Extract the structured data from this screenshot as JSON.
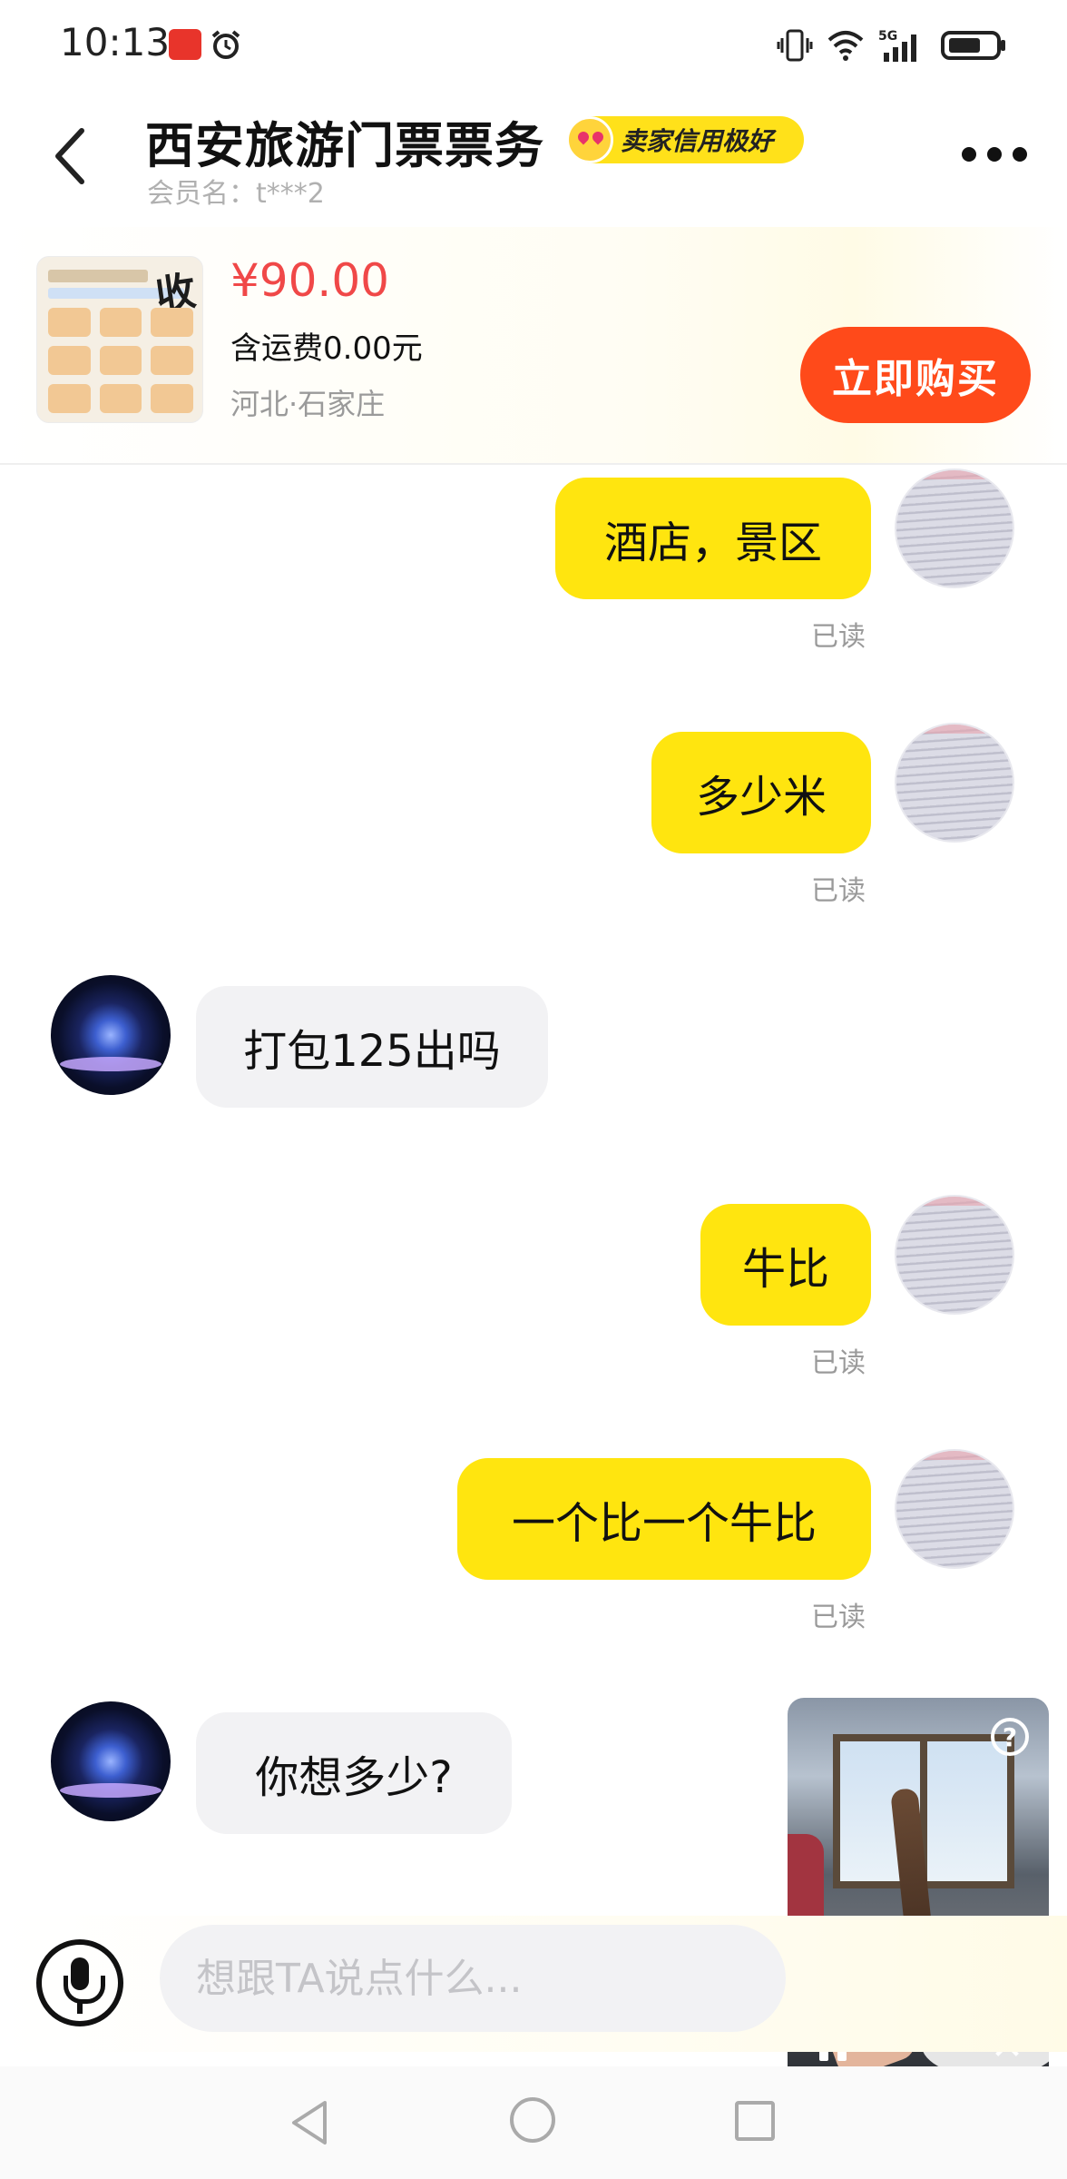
{
  "status_bar": {
    "time": "10:13",
    "icons": [
      "app-notification-icon",
      "alarm-icon",
      "vibrate-icon",
      "wifi-icon",
      "5g-signal-icon",
      "battery-icon"
    ]
  },
  "header": {
    "title": "西安旅游门票票务",
    "credit_badge": "卖家信用极好",
    "member": "会员名：t***2"
  },
  "product": {
    "thumbnail_stamp": "收",
    "price": "¥90.00",
    "shipping": "含运费0.00元",
    "location": "河北·石家庄",
    "buy_label": "立即购买",
    "price_color": "#f04848",
    "buy_color": "#ff4a1a"
  },
  "messages": [
    {
      "side": "mine",
      "text": "酒店，景区",
      "status": "已读"
    },
    {
      "side": "mine",
      "text": "多少米",
      "status": "已读"
    },
    {
      "side": "theirs",
      "text": "打包125出吗"
    },
    {
      "side": "mine",
      "text": "牛比",
      "status": "已读"
    },
    {
      "side": "mine",
      "text": "一个比一个牛比",
      "status": "已读"
    },
    {
      "side": "theirs",
      "text": "你想多少?"
    }
  ],
  "video_pip": {
    "help_label": "?",
    "close_label": "✕"
  },
  "input": {
    "placeholder": "想跟TA说点什么..."
  },
  "colors": {
    "my_bubble": "#ffe50f",
    "their_bubble": "#f2f2f4"
  }
}
